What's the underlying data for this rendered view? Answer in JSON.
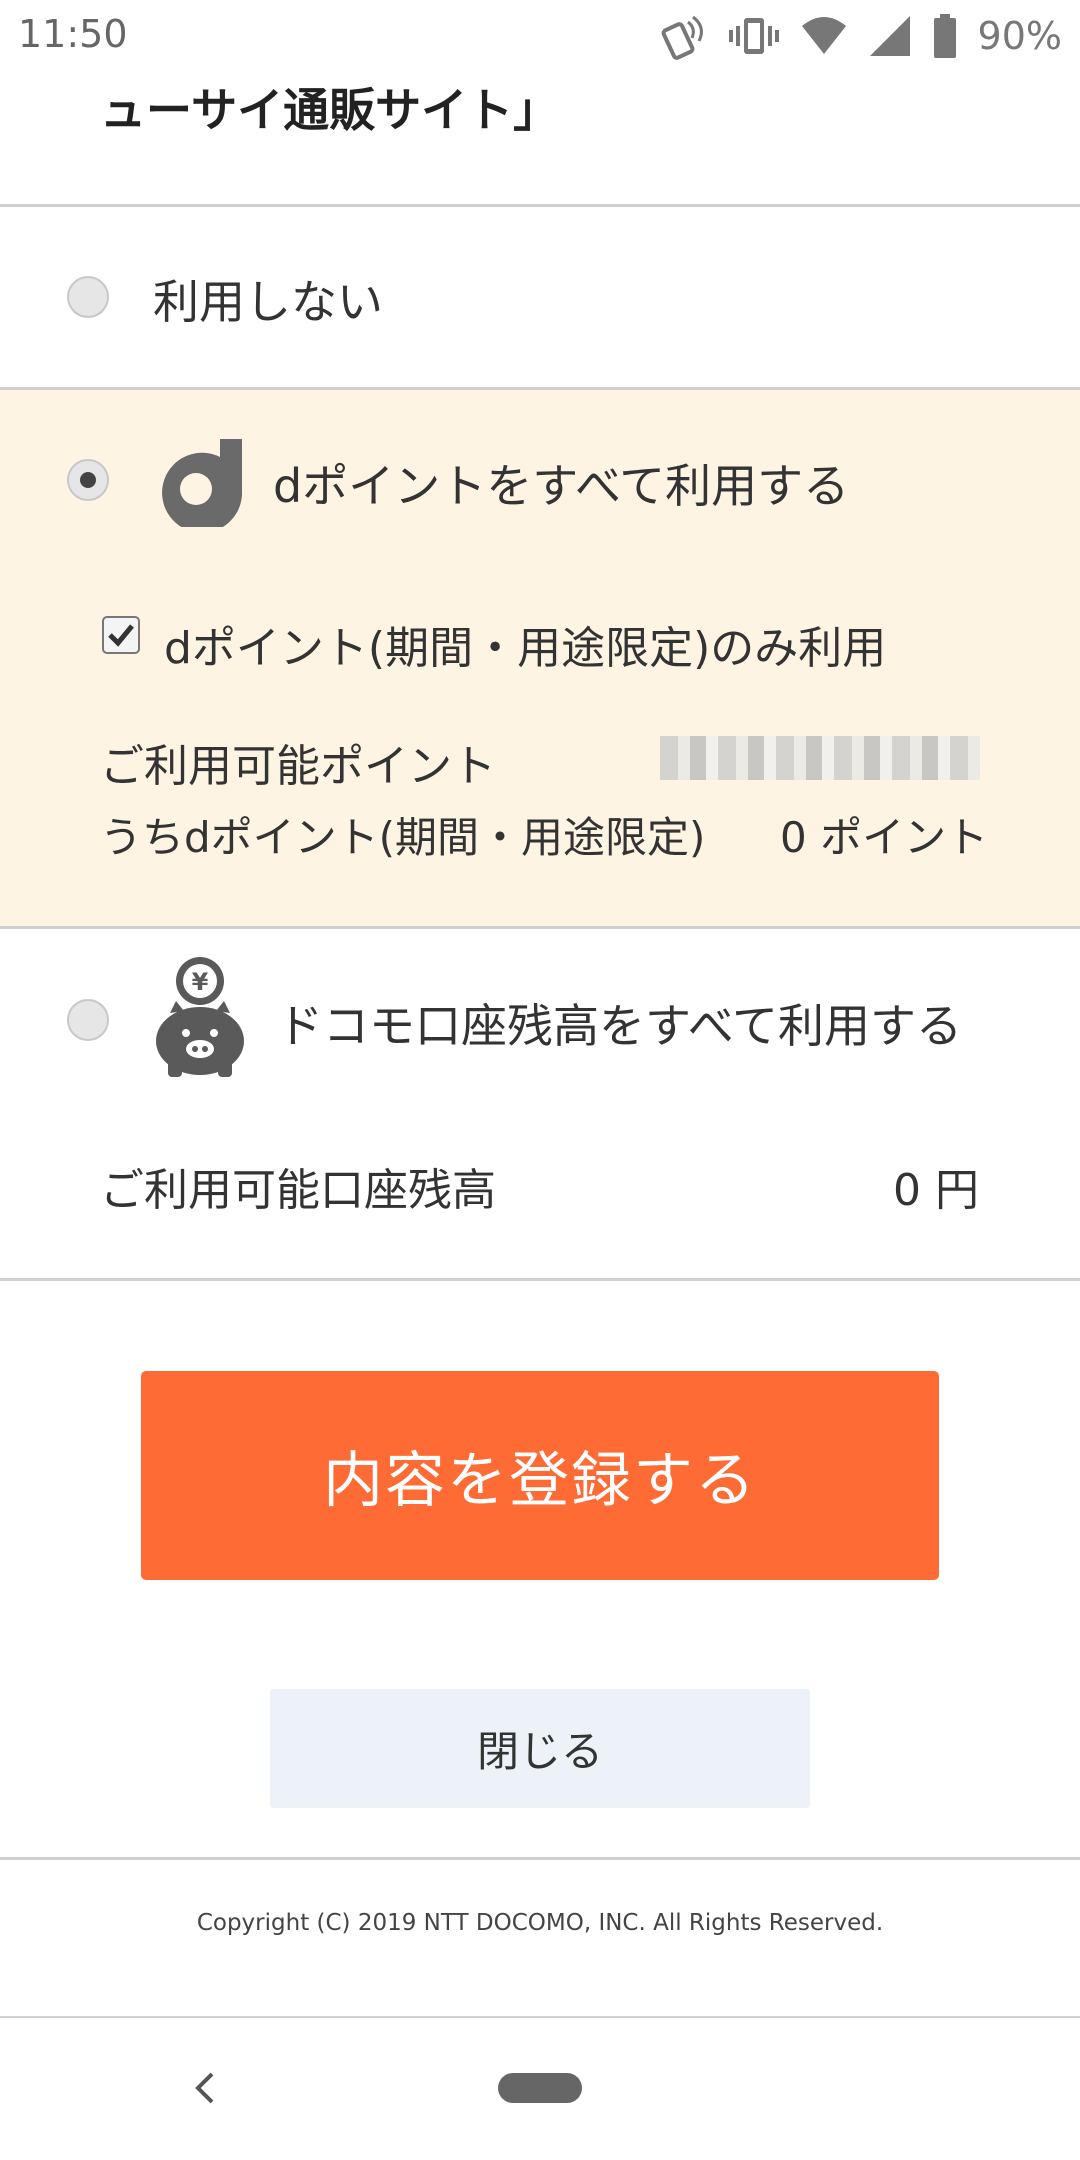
{
  "status_bar": {
    "time": "11:50",
    "battery": "90%",
    "icons": [
      "nfc-icon",
      "vibrate-icon",
      "wifi-icon",
      "cell-signal-icon",
      "battery-icon"
    ]
  },
  "header": {
    "title_fragment": "ューサイ通販サイト」"
  },
  "options": {
    "none": {
      "label": "利用しない",
      "selected": false
    },
    "dpoint": {
      "label": "dポイントをすべて利用する",
      "selected": true,
      "logo_letter": "d",
      "limited_only_label": "dポイント(期間・用途限定)のみ利用",
      "limited_only_checked": true,
      "available_points_label": "ご利用可能ポイント",
      "limited_points_label": "うちdポイント(期間・用途限定)",
      "limited_points_value": "0 ポイント"
    },
    "docomo_account": {
      "label": "ドコモ口座残高をすべて利用する",
      "selected": false,
      "icon_symbol": "¥",
      "available_balance_label": "ご利用可能口座残高",
      "available_balance_value": "0 円"
    }
  },
  "actions": {
    "register_label": "内容を登録する",
    "close_label": "閉じる"
  },
  "footer": {
    "copyright": "Copyright (C) 2019 NTT DOCOMO, INC. All Rights Reserved."
  },
  "colors": {
    "accent_orange": "#ff6b35",
    "highlight_bg": "#fdf4e3",
    "close_button_bg": "#edf1f8",
    "divider": "#d0d0d0"
  }
}
